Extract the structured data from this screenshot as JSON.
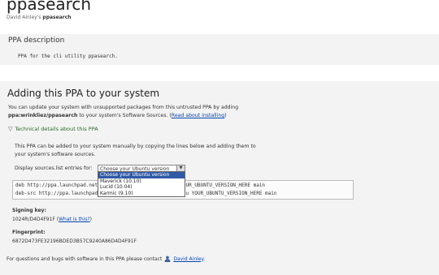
{
  "page": {
    "title": "ppasearch",
    "owner": "David Ainley's",
    "ppa_name": "ppasearch"
  },
  "description": {
    "heading": "PPA description",
    "text": "PPA for the cli utility ppasearch."
  },
  "adding": {
    "heading": "Adding this PPA to your system",
    "intro_1": "You can update your system with unsupported packages from this untrusted PPA by adding",
    "ppa_ref": "ppa:wrinkliez/ppasearch",
    "intro_2": " to your system's Software Sources. (",
    "read_about": "Read about installing",
    "intro_3": ")",
    "technical_toggle": "Technical details about this PPA",
    "manual_note": "This PPA can be added to your system manually by copying the lines below and adding them to your system's software sources.",
    "display_label": "Display sources.list entries for:",
    "select_value": "Choose your Ubuntu version",
    "dropdown_options": [
      "Choose your Ubuntu version",
      "Maverick (10.10)",
      "Lucid (10.04)",
      "Karmic (9.10)"
    ],
    "selected_index": 0,
    "sources": {
      "line1": "deb http://ppa.launchpad.net/wrinkliez/ppasearch/ubuntu YOUR_UBUNTU_VERSION_HERE main",
      "line2": "deb-src http://ppa.launchpad.net/wrinkliez/ppasearch/ubuntu YOUR_UBUNTU_VERSION_HERE main"
    },
    "signing_label": "Signing key:",
    "signing_key": "1024R/D4D4F91F",
    "what_is_this": "What is this?",
    "fingerprint_label": "Fingerprint:",
    "fingerprint": "6872D473FE32196BDED3B57C9240A86D4D4F91F",
    "contact_text": "For questions and bugs with software in this PPA please contact",
    "contact_name": "David Ainley",
    "contact_end": "."
  },
  "icons": {
    "toggle": "triangle-down-icon",
    "person": "person-icon",
    "select_arrow": "chevron-down-icon"
  },
  "colors": {
    "link": "#0645ad",
    "band": "#f3f3f3",
    "selected_option": "#2f5aa8"
  }
}
